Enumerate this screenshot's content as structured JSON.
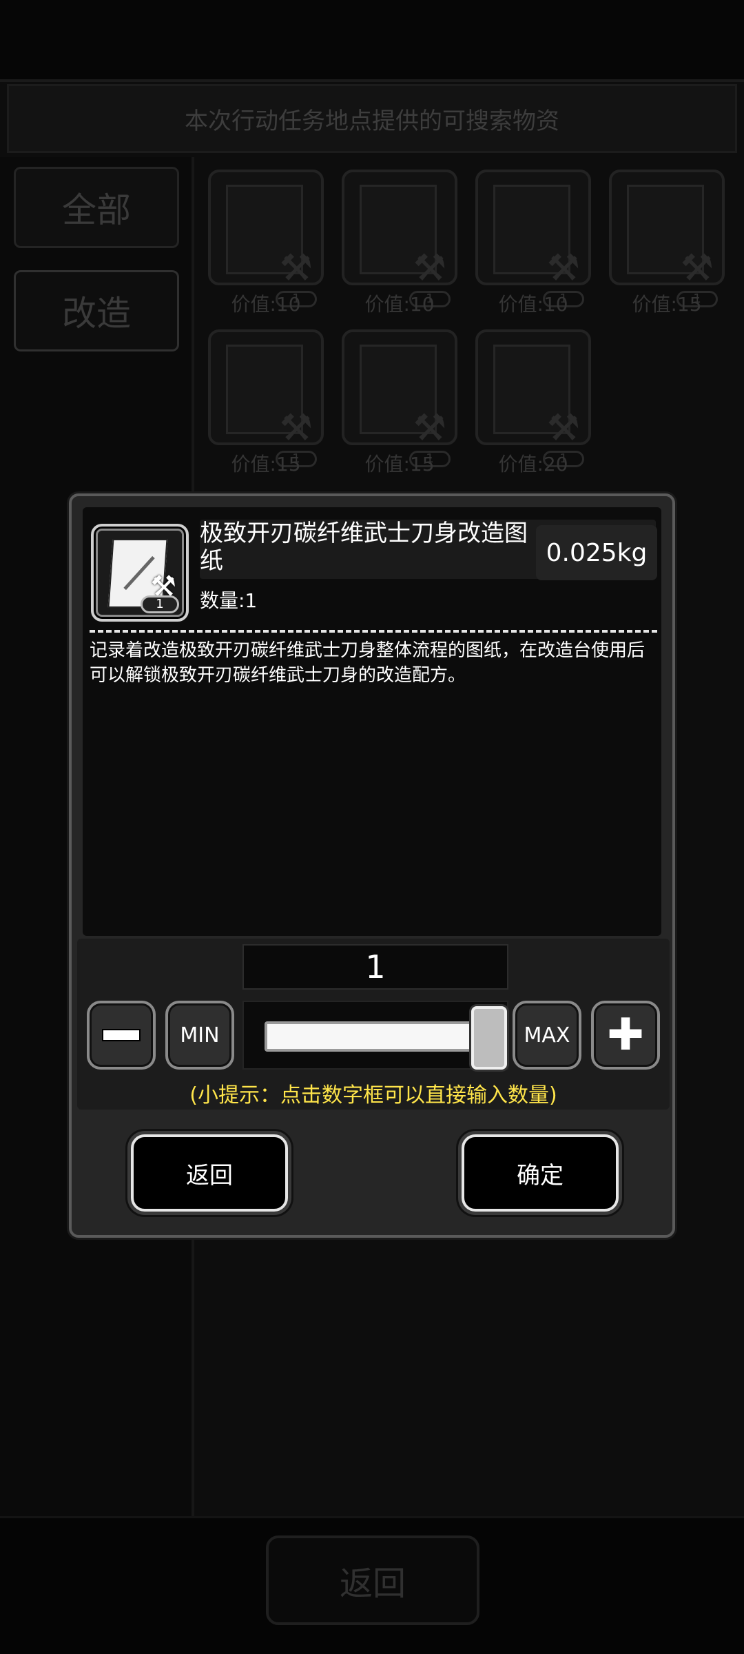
{
  "background": {
    "header_text": "本次行动任务地点提供的可搜索物资",
    "categories": [
      {
        "label": "全部",
        "active": false
      },
      {
        "label": "改造",
        "active": true
      }
    ],
    "items": [
      {
        "count": "1",
        "price": "价值:10"
      },
      {
        "count": "1",
        "price": "价值:10"
      },
      {
        "count": "1",
        "price": "价值:10"
      },
      {
        "count": "1",
        "price": "价值:15"
      },
      {
        "count": "1",
        "price": "价值:15"
      },
      {
        "count": "1",
        "price": "价值:15"
      },
      {
        "count": "1",
        "price": "价值:20"
      }
    ],
    "back_label": "返回"
  },
  "dialog": {
    "item_icon": "blueprint-icon",
    "tool_icon": "hammer-wrench-icon",
    "badge_count": "1",
    "title": "极致开刃碳纤维武士刀身改造图纸",
    "weight": "0.025kg",
    "quantity_label": "数量:1",
    "description": "记录着改造极致开刃碳纤维武士刀身整体流程的图纸，在改造台使用后可以解锁极致开刃碳纤维武士刀身的改造配方。",
    "quantity_value": "1",
    "slider_level": 1.0,
    "min_label": "MIN",
    "max_label": "MAX",
    "plus_glyph": "✚",
    "hint": "(小提示：点击数字框可以直接输入数量)",
    "back_label": "返回",
    "confirm_label": "确定",
    "hint_color": "#ffe54a"
  }
}
